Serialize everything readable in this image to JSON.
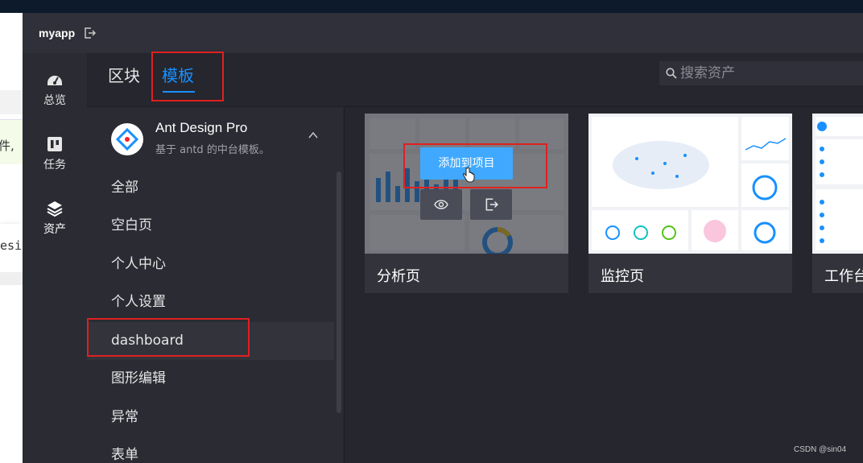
{
  "background_page": {
    "text_fragment_1": "件,",
    "text_fragment_2": "esi"
  },
  "window": {
    "app_name": "myapp"
  },
  "left_nav": {
    "items": [
      {
        "label": "总览",
        "icon": "dashboard-gauge-icon"
      },
      {
        "label": "任务",
        "icon": "trello-board-icon"
      },
      {
        "label": "资产",
        "icon": "layers-icon"
      }
    ]
  },
  "tabs": [
    {
      "label": "区块",
      "active": false
    },
    {
      "label": "模板",
      "active": true
    }
  ],
  "search": {
    "placeholder": "搜索资产"
  },
  "template_group": {
    "title": "Ant Design Pro",
    "description": "基于 antd 的中台模板。"
  },
  "categories": [
    {
      "label": "全部"
    },
    {
      "label": "空白页"
    },
    {
      "label": "个人中心"
    },
    {
      "label": "个人设置"
    },
    {
      "label": "dashboard",
      "selected": true
    },
    {
      "label": "图形编辑"
    },
    {
      "label": "异常"
    },
    {
      "label": "表单"
    }
  ],
  "cards": [
    {
      "label": "分析页",
      "hover_action": "添加到项目"
    },
    {
      "label": "监控页"
    },
    {
      "label": "工作台"
    }
  ],
  "colors": {
    "accent": "#1890ff",
    "button": "#40a9ff",
    "highlight_box": "#e02020",
    "panel_bg": "#25262e"
  },
  "watermark": "CSDN @sin04"
}
